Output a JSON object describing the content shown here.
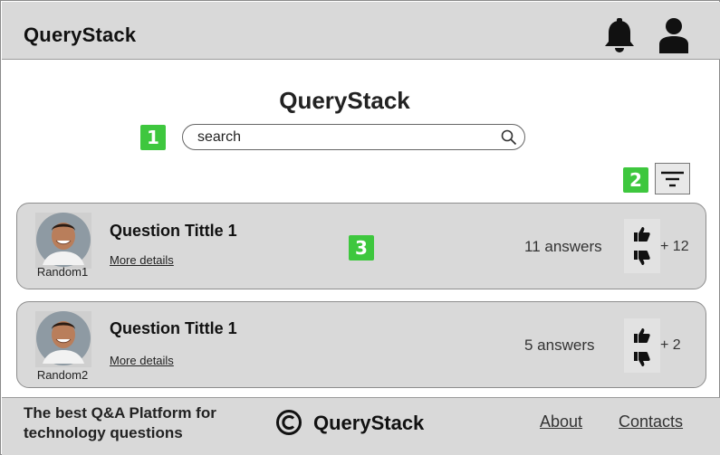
{
  "header": {
    "brand": "QueryStack"
  },
  "main": {
    "title": "QueryStack",
    "search": {
      "value": "search",
      "placeholder": "search"
    },
    "badges": [
      "1",
      "2",
      "3"
    ]
  },
  "questions": [
    {
      "author": "Random1",
      "title": "Question Tittle 1",
      "more": "More details",
      "answers": "11 answers",
      "score": "+ 12"
    },
    {
      "author": "Random2",
      "title": "Question Tittle 1",
      "more": "More details",
      "answers": "5 answers",
      "score": "+ 2"
    }
  ],
  "footer": {
    "tagline": "The best Q&A Platform for technology questions",
    "brand": "QueryStack",
    "links": [
      "About",
      "Contacts"
    ]
  },
  "colors": {
    "bar": "#d9d9d9",
    "badge": "#3ec73e",
    "icon": "#111111"
  },
  "icons": [
    "bell-icon",
    "user-icon",
    "search-icon",
    "filter-icon",
    "thumbs-up-icon",
    "thumbs-down-icon",
    "copyright-icon"
  ]
}
